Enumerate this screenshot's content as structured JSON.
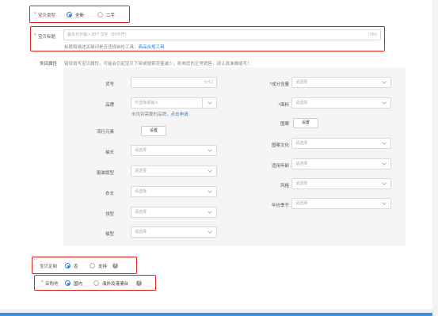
{
  "item_type": {
    "required": "*",
    "label": "宝贝类型",
    "options": [
      "全新",
      "二手"
    ],
    "selected": 0
  },
  "item_title": {
    "required": "*",
    "label": "宝贝标题",
    "placeholder": "最多允许输入30个汉字（60字符）",
    "counter": "0/60",
    "hint": "标题和描述关键词是否违规自检工具：",
    "hint_link": "商品合规工具"
  },
  "category_attrs": {
    "label": "类目属性",
    "notice": "错误填写宝贝属性，可能会引起宝贝下架或搜索流量减少，影响您的正常销售，请认真准确填写！",
    "left": [
      {
        "label": "货号",
        "type": "input",
        "value": "",
        "counter": "0/42"
      },
      {
        "label": "品牌",
        "type": "combo",
        "placeholder": "可选择或输入"
      },
      {
        "label": "流行元素",
        "type": "button",
        "button_label": "设置"
      },
      {
        "label": "袖长",
        "type": "select",
        "placeholder": "请选择"
      },
      {
        "label": "服装版型",
        "type": "select",
        "placeholder": "请选择"
      },
      {
        "label": "衣长",
        "type": "select",
        "placeholder": "请选择"
      },
      {
        "label": "领型",
        "type": "select",
        "placeholder": "请选择"
      },
      {
        "label": "袖型",
        "type": "select",
        "placeholder": "请选择"
      }
    ],
    "brand_hint": "未找到需要的品牌，",
    "brand_hint_link": "点击申请",
    "right": [
      {
        "required": "*",
        "label": "成分含量",
        "type": "select",
        "placeholder": "请选择"
      },
      {
        "required": "*",
        "label": "面料",
        "type": "select",
        "placeholder": "请选择"
      },
      {
        "label": "图案",
        "type": "button",
        "button_label": "设置"
      },
      {
        "label": "图案文化",
        "type": "select",
        "placeholder": "请选择"
      },
      {
        "label": "适用年龄",
        "type": "select",
        "placeholder": "请选择"
      },
      {
        "label": "风格",
        "type": "select",
        "placeholder": "请选择"
      },
      {
        "label": "年份季节",
        "type": "select",
        "placeholder": "请选择"
      }
    ]
  },
  "customization": {
    "label": "宝贝定制",
    "options": [
      "否",
      "支持"
    ],
    "selected": 0,
    "help": "?"
  },
  "purchase_location": {
    "required": "*",
    "label": "采购地",
    "options": [
      "国内",
      "海外及港澳台"
    ],
    "selected": 0,
    "help": "?"
  },
  "colors": {
    "accent": "#2d7de0",
    "highlight_border": "#e0201a",
    "required_star": "#f23030"
  }
}
